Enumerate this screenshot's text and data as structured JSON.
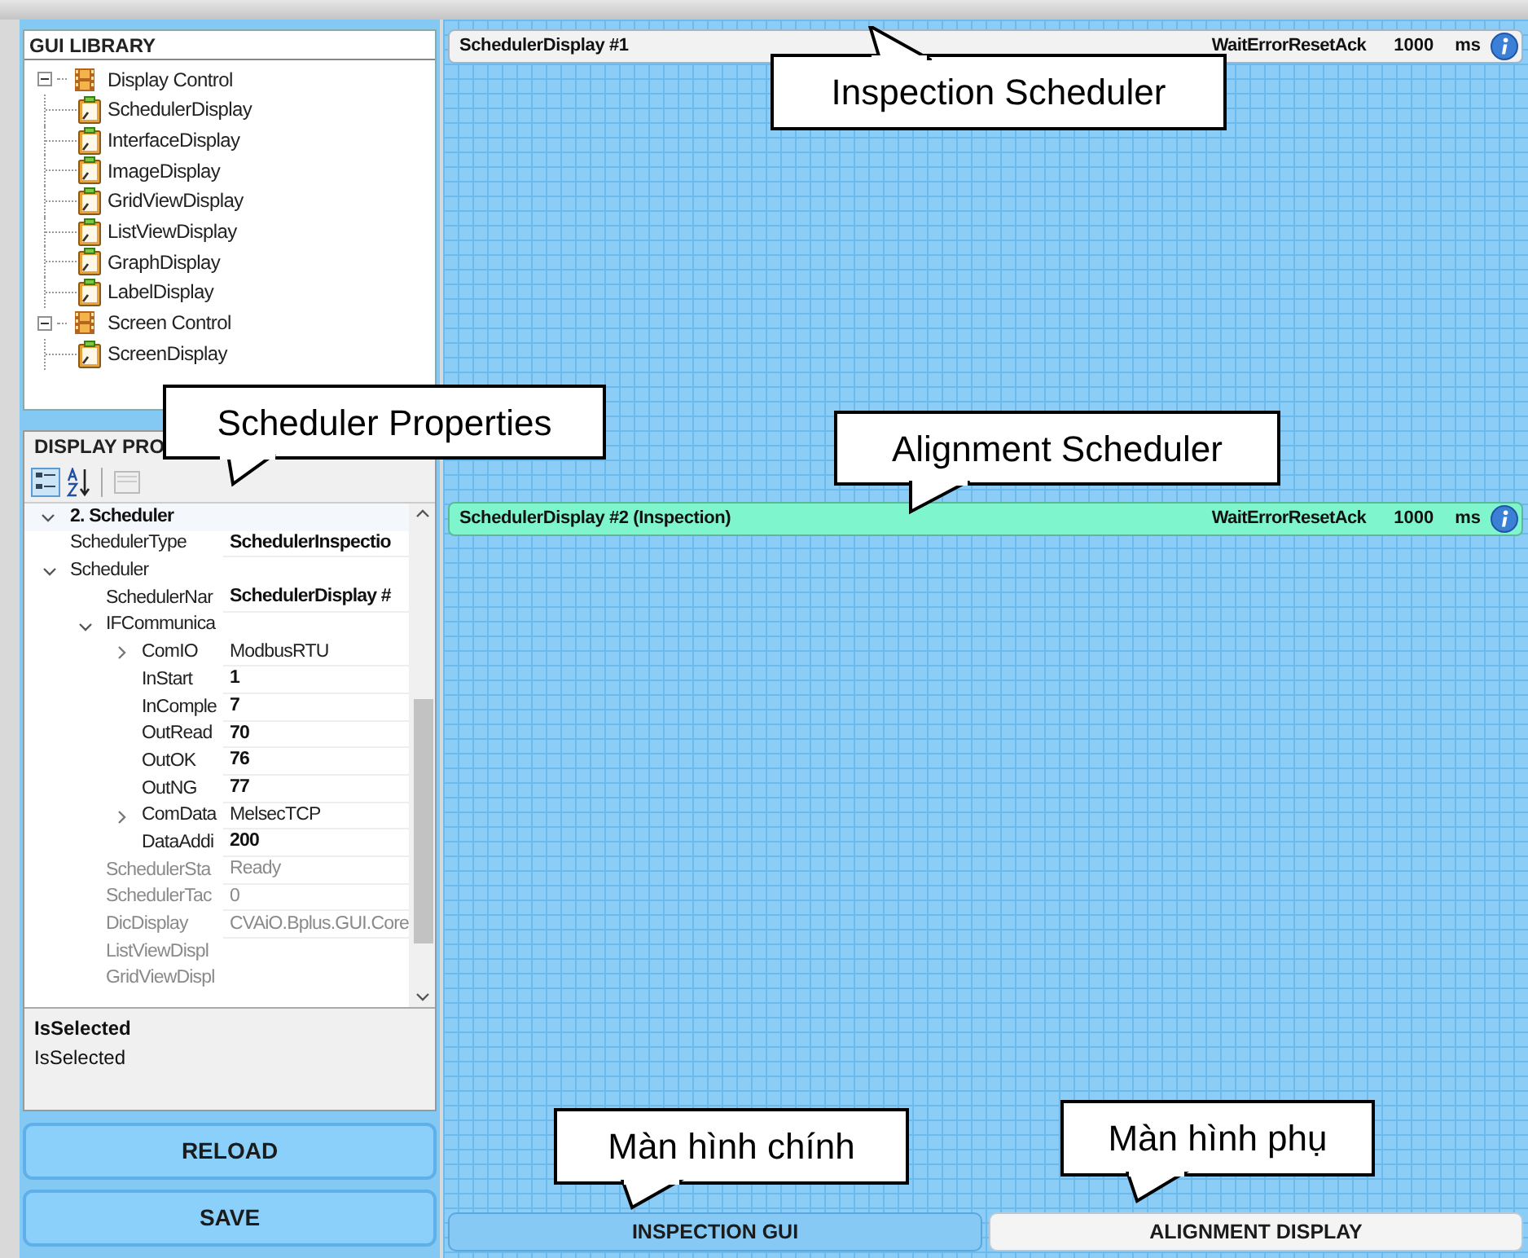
{
  "gui_library": {
    "title": "GUI LIBRARY",
    "tree": [
      {
        "label": "Display Control",
        "expanded": true,
        "children": [
          {
            "label": "SchedulerDisplay"
          },
          {
            "label": "InterfaceDisplay"
          },
          {
            "label": "ImageDisplay"
          },
          {
            "label": "GridViewDisplay"
          },
          {
            "label": "ListViewDisplay"
          },
          {
            "label": "GraphDisplay"
          },
          {
            "label": "LabelDisplay"
          }
        ]
      },
      {
        "label": "Screen Control",
        "expanded": true,
        "children": [
          {
            "label": "ScreenDisplay"
          }
        ]
      }
    ]
  },
  "display_properties": {
    "title": "DISPLAY PRO",
    "rows": [
      {
        "kind": "category",
        "name": "2. Scheduler",
        "expanded": true,
        "children": [
          {
            "name": "SchedulerType",
            "value": "SchedulerInspectio",
            "bold": true
          },
          {
            "name": "Scheduler",
            "expanded": true,
            "children": [
              {
                "name": "SchedulerNar",
                "value": "SchedulerDisplay #",
                "bold": true
              },
              {
                "name": "IFCommunica",
                "expanded": true,
                "children": [
                  {
                    "name": "ComIO",
                    "value": "ModbusRTU",
                    "expanded": false
                  },
                  {
                    "name": "InStart",
                    "value": "1",
                    "bold": true
                  },
                  {
                    "name": "InComple",
                    "value": "7",
                    "bold": true
                  },
                  {
                    "name": "OutRead",
                    "value": "70",
                    "bold": true
                  },
                  {
                    "name": "OutOK",
                    "value": "76",
                    "bold": true
                  },
                  {
                    "name": "OutNG",
                    "value": "77",
                    "bold": true
                  },
                  {
                    "name": "ComData",
                    "value": "MelsecTCP",
                    "expanded": false
                  },
                  {
                    "name": "DataAddi",
                    "value": "200",
                    "bold": true
                  }
                ]
              },
              {
                "name": "SchedulerSta",
                "value": "Ready",
                "disabled": true
              },
              {
                "name": "SchedulerTac",
                "value": "0",
                "disabled": true
              },
              {
                "name": "DicDisplay",
                "value": "CVAiO.Bplus.GUI.Core",
                "disabled": true
              },
              {
                "name": "ListViewDispl",
                "disabled": true
              },
              {
                "name": "GridViewDispl",
                "disabled": true
              }
            ]
          }
        ]
      }
    ],
    "description": {
      "title": "IsSelected",
      "text": "IsSelected"
    }
  },
  "buttons": [
    {
      "label": "RELOAD"
    },
    {
      "label": "SAVE"
    }
  ],
  "schedulers": [
    {
      "title": "SchedulerDisplay #1",
      "selected": false,
      "status": "WaitErrorResetAck",
      "interval": "1000",
      "unit": "ms"
    },
    {
      "title": "SchedulerDisplay #2 (Inspection)",
      "selected": true,
      "status": "WaitErrorResetAck",
      "interval": "1000",
      "unit": "ms"
    }
  ],
  "screen_tabs": [
    {
      "label": "INSPECTION GUI",
      "selected": false
    },
    {
      "label": "ALIGNMENT DISPLAY",
      "selected": true
    }
  ],
  "callouts": [
    {
      "text": "Scheduler Properties"
    },
    {
      "text": "Inspection Scheduler"
    },
    {
      "text": "Alignment Scheduler"
    },
    {
      "text": "Màn hình chính"
    },
    {
      "text": "Màn hình phụ"
    }
  ]
}
